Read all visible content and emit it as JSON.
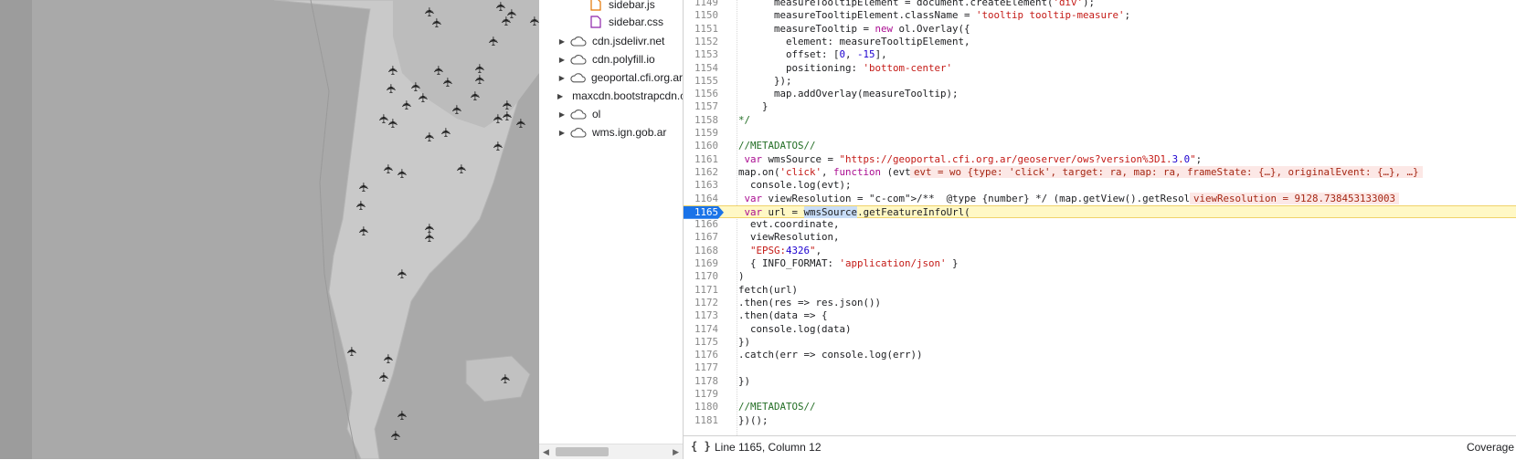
{
  "navigator": {
    "files": [
      {
        "name": "sidebar.js",
        "icon": "js-file-icon",
        "color": "#e37400"
      },
      {
        "name": "sidebar.css",
        "icon": "css-file-icon",
        "color": "#8e24aa"
      }
    ],
    "domains": [
      {
        "name": "cdn.jsdelivr.net"
      },
      {
        "name": "cdn.polyfill.io"
      },
      {
        "name": "geoportal.cfi.org.ar"
      },
      {
        "name": "maxcdn.bootstrapcdn.com"
      },
      {
        "name": "ol"
      },
      {
        "name": "wms.ign.gob.ar"
      }
    ]
  },
  "editor": {
    "current_line": 1165,
    "inline_values": {
      "evt": "evt = wo {type: 'click', target: ra, map: ra, frameState: {…}, originalEvent: {…}, …}",
      "viewResolution": "viewResolution = 9128.738453133003"
    },
    "lines": [
      {
        "n": "1149",
        "text": "      measureTooltipElement = document.createElement('div');"
      },
      {
        "n": "1150",
        "text": "      measureTooltipElement.className = 'tooltip tooltip-measure';"
      },
      {
        "n": "1151",
        "text": "      measureTooltip = new ol.Overlay({"
      },
      {
        "n": "1152",
        "text": "        element: measureTooltipElement,"
      },
      {
        "n": "1153",
        "text": "        offset: [0, -15],"
      },
      {
        "n": "1154",
        "text": "        positioning: 'bottom-center'"
      },
      {
        "n": "1155",
        "text": "      });"
      },
      {
        "n": "1156",
        "text": "      map.addOverlay(measureTooltip);"
      },
      {
        "n": "1157",
        "text": "    }"
      },
      {
        "n": "1158",
        "text": "*/"
      },
      {
        "n": "1159",
        "text": ""
      },
      {
        "n": "1160",
        "text": "//METADATOS//"
      },
      {
        "n": "1161",
        "text": " var wmsSource = \"https://geoportal.cfi.org.ar/geoserver/ows?version%3D1.3.0\";"
      },
      {
        "n": "1162",
        "text": "map.on('click', function (evt) {"
      },
      {
        "n": "1163",
        "text": "  console.log(evt);"
      },
      {
        "n": "1164",
        "text": " var viewResolution = /**  @type {number} */ (map.getView().getResolution())"
      },
      {
        "n": "1165",
        "text": " var url = wmsSource.getFeatureInfoUrl("
      },
      {
        "n": "1166",
        "text": "  evt.coordinate,"
      },
      {
        "n": "1167",
        "text": "  viewResolution,"
      },
      {
        "n": "1168",
        "text": "  \"EPSG:4326\","
      },
      {
        "n": "1169",
        "text": "  { INFO_FORMAT: 'application/json' }"
      },
      {
        "n": "1170",
        "text": ")"
      },
      {
        "n": "1171",
        "text": "fetch(url)"
      },
      {
        "n": "1172",
        "text": ".then(res => res.json())"
      },
      {
        "n": "1173",
        "text": ".then(data => {"
      },
      {
        "n": "1174",
        "text": "  console.log(data)"
      },
      {
        "n": "1175",
        "text": "})"
      },
      {
        "n": "1176",
        "text": ".catch(err => console.log(err))"
      },
      {
        "n": "1177",
        "text": ""
      },
      {
        "n": "1178",
        "text": "})"
      },
      {
        "n": "1179",
        "text": ""
      },
      {
        "n": "1180",
        "text": "//METADATOS//"
      },
      {
        "n": "1181",
        "text": "})();"
      }
    ]
  },
  "status_bar": {
    "braces": "{ }",
    "position": "Line 1165, Column 12",
    "coverage": "Coverage"
  },
  "colors": {
    "map_background": "#a8a8a8",
    "land": "#c8c8c8",
    "current_line_badge": "#1a73e8",
    "current_line_bg": "#fff8c5",
    "inline_value_bg": "#fce8e6"
  }
}
